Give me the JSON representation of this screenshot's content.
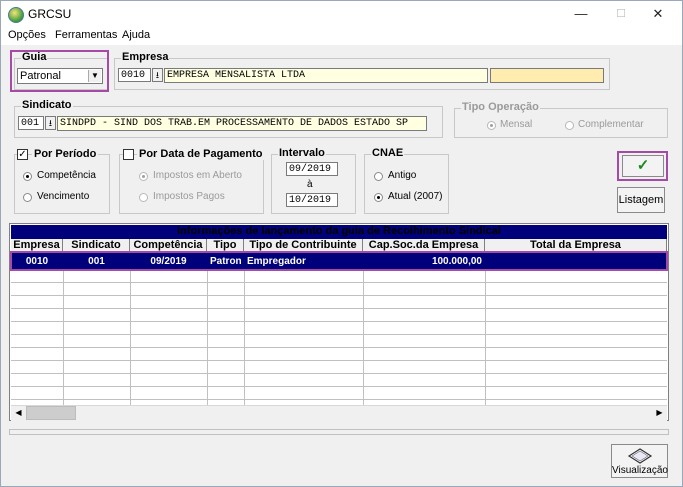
{
  "window": {
    "title": "GRCSU",
    "minimize": "—",
    "maximize": "☐",
    "close": "✕"
  },
  "menu": [
    "Opções",
    "Ferramentas",
    "Ajuda"
  ],
  "guia": {
    "label": "Guia",
    "value": "Patronal"
  },
  "empresa": {
    "label": "Empresa",
    "code": "0010",
    "name": "EMPRESA MENSALISTA LTDA",
    "extra": ""
  },
  "sindicato": {
    "label": "Sindicato",
    "code": "001",
    "name": "SINDPD - SIND DOS TRAB.EM PROCESSAMENTO DE DADOS ESTADO SP"
  },
  "tipo_operacao": {
    "label": "Tipo Operação",
    "options": [
      {
        "label": "Mensal",
        "selected": true
      },
      {
        "label": "Complementar",
        "selected": false
      }
    ]
  },
  "por_periodo": {
    "label": "Por Período",
    "checked": true,
    "options": [
      {
        "label": "Competência",
        "selected": true
      },
      {
        "label": "Vencimento",
        "selected": false
      }
    ]
  },
  "por_data_pagamento": {
    "label": "Por Data de Pagamento",
    "checked": false,
    "options": [
      {
        "label": "Impostos em Aberto",
        "selected": true
      },
      {
        "label": "Impostos Pagos",
        "selected": false
      }
    ]
  },
  "intervalo": {
    "label": "Intervalo",
    "from": "09/2019",
    "sep": "à",
    "to": "10/2019"
  },
  "cnae": {
    "label": "CNAE",
    "options": [
      {
        "label": "Antigo",
        "selected": false
      },
      {
        "label": "Atual (2007)",
        "selected": true
      }
    ]
  },
  "buttons": {
    "ok_icon": "✓",
    "listagem": "Listagem",
    "visualizacao": "Visualização"
  },
  "grid": {
    "band_title": "Informações de lançamento da guia de Recolhimento Sindical",
    "columns": [
      "Empresa",
      "Sindicato",
      "Competência",
      "Tipo",
      "Tipo de Contribuinte",
      "Cap.Soc.da Empresa",
      "Total da Empresa"
    ],
    "rows": [
      [
        "0010",
        "001",
        "09/2019",
        "Patron",
        "Empregador",
        "100.000,00",
        ""
      ]
    ]
  },
  "colors": {
    "selection": "#00007a",
    "highlight": "#a64aa8",
    "yellow_field": "#ffffe1"
  },
  "icons": {
    "ok": "check-icon",
    "visualizacao": "preview-icon",
    "app": "app-icon"
  }
}
